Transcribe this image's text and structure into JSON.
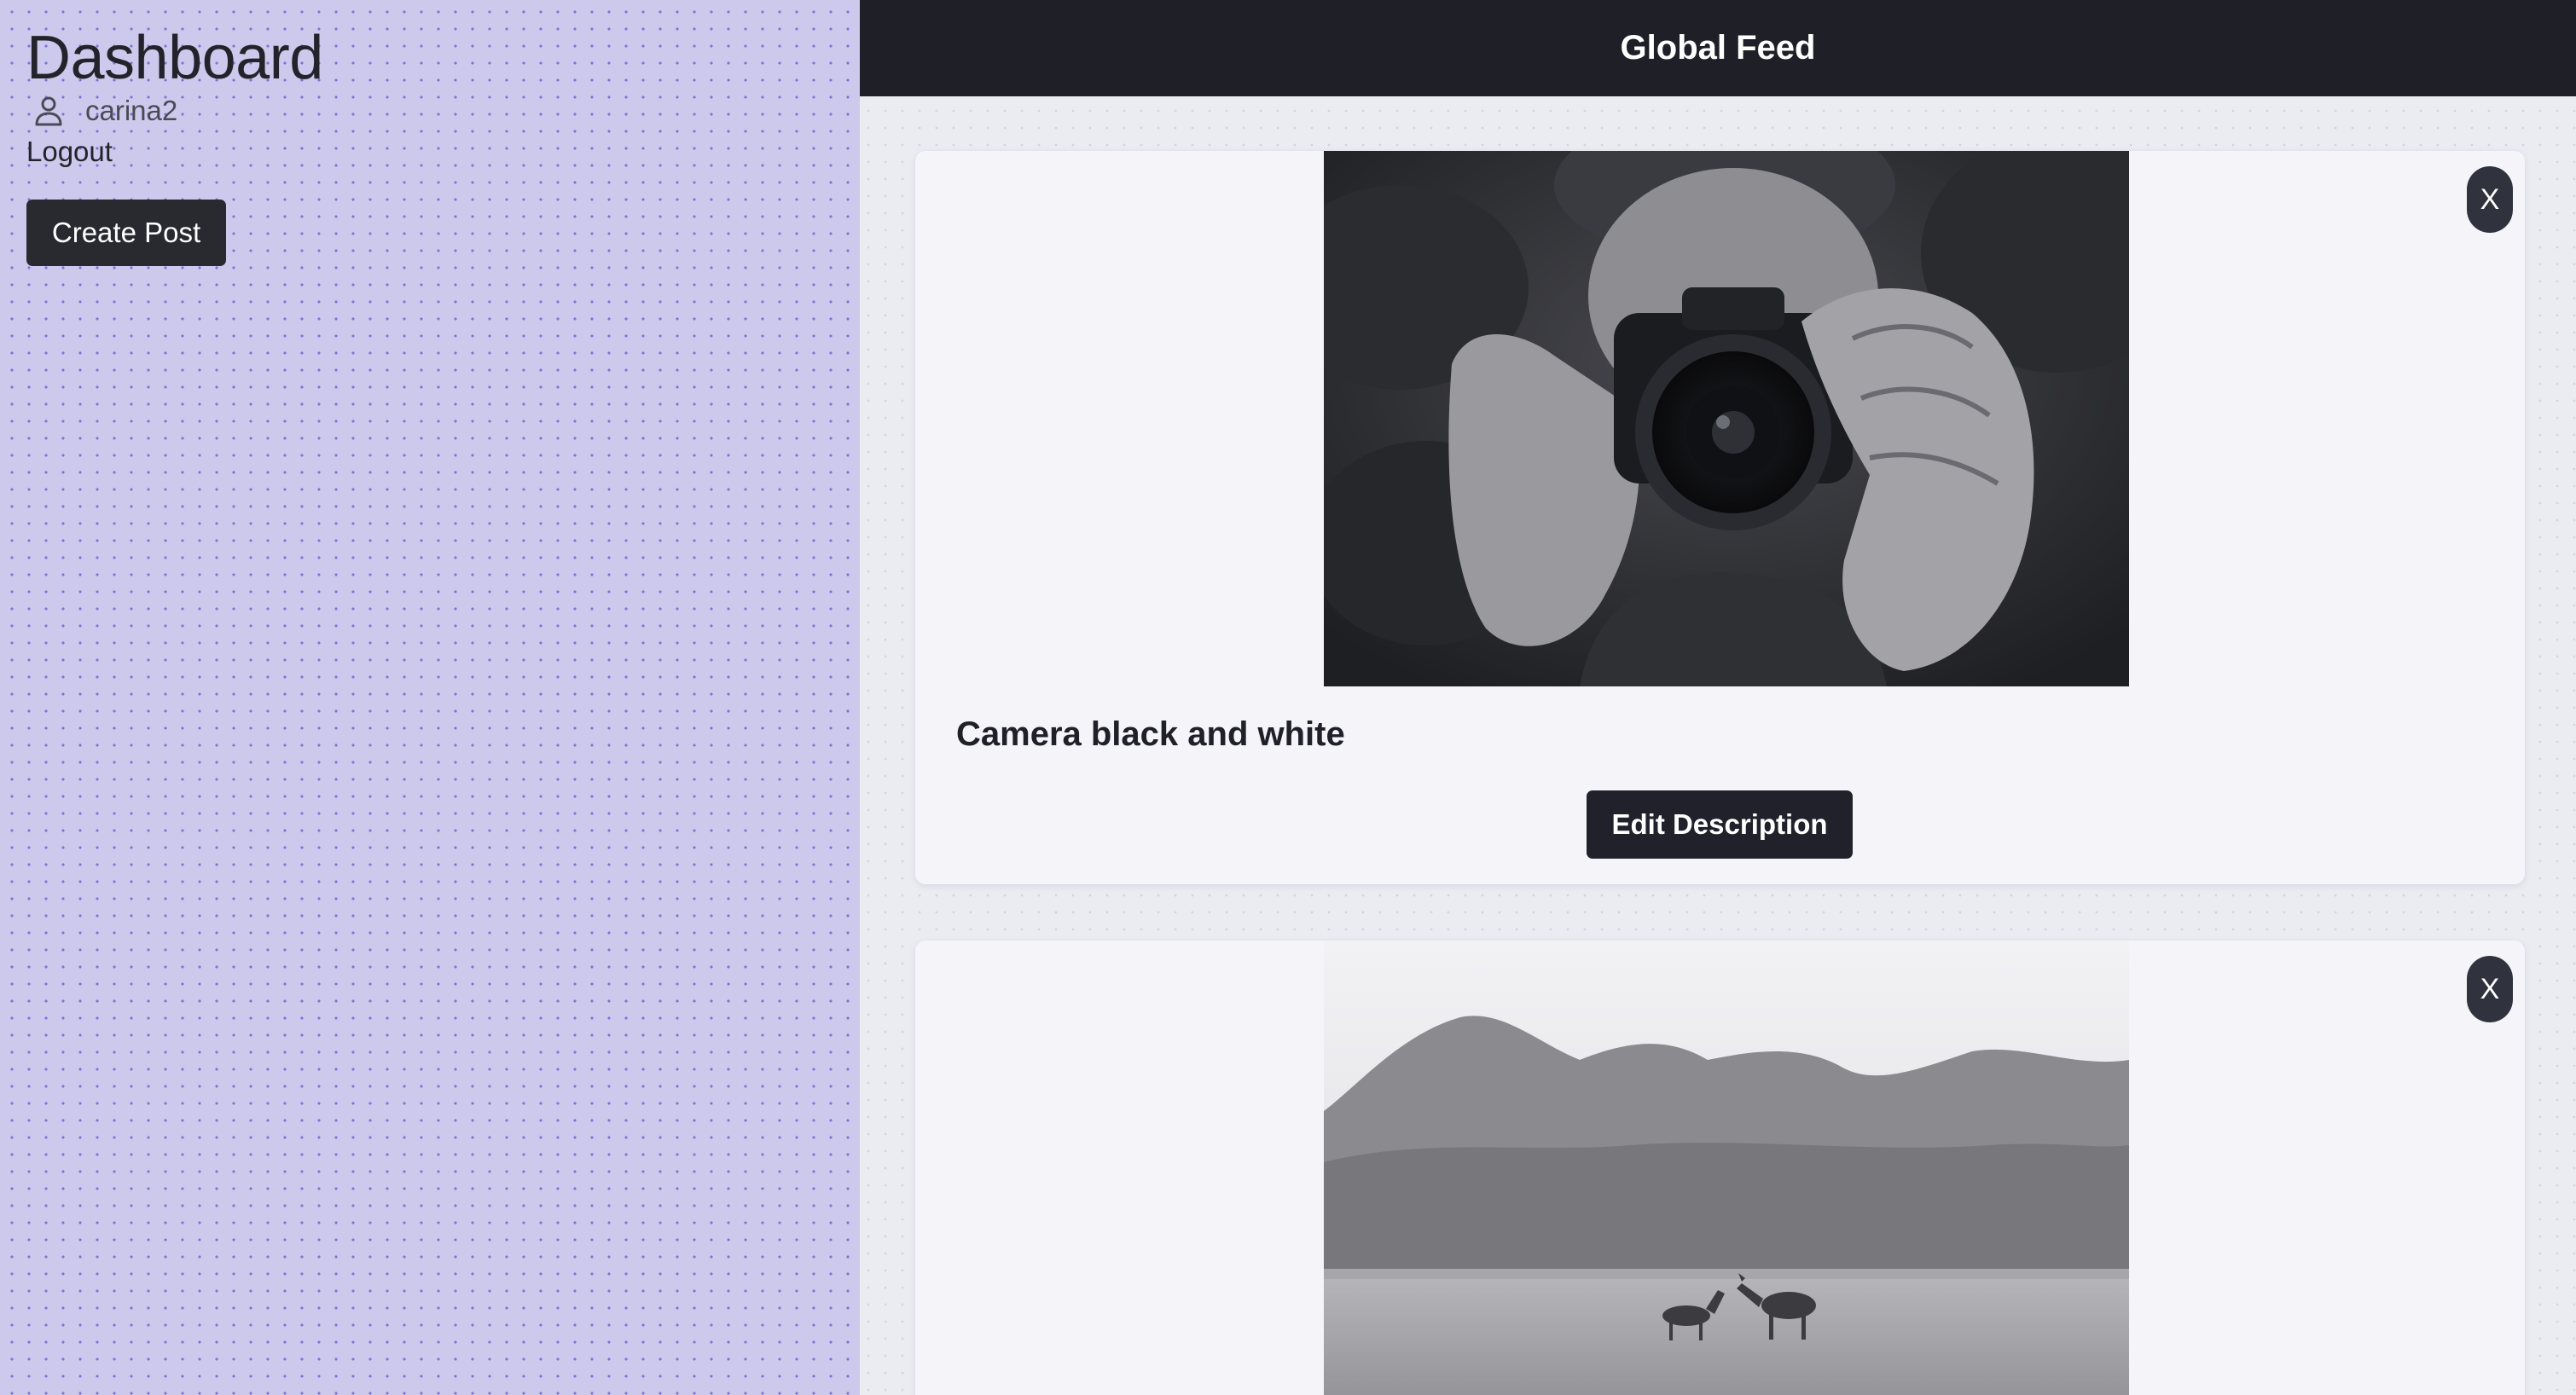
{
  "sidebar": {
    "title": "Dashboard",
    "username": "carina2",
    "user_icon": "user-icon",
    "logout_label": "Logout",
    "create_post_label": "Create Post",
    "background_color": "#ccc9ec",
    "dot_color": "#7b74d6"
  },
  "header": {
    "title": "Global Feed",
    "background_color": "#1f2027"
  },
  "posts": [
    {
      "description": "Camera black and white",
      "close_label": "X",
      "edit_label": "Edit Description",
      "image": "camera-photo"
    },
    {
      "description": "",
      "close_label": "X",
      "image": "deer-field-photo"
    }
  ],
  "colors": {
    "button_dark": "#292a30",
    "card_background": "#f4f4f9",
    "main_background": "#ebebf2"
  }
}
